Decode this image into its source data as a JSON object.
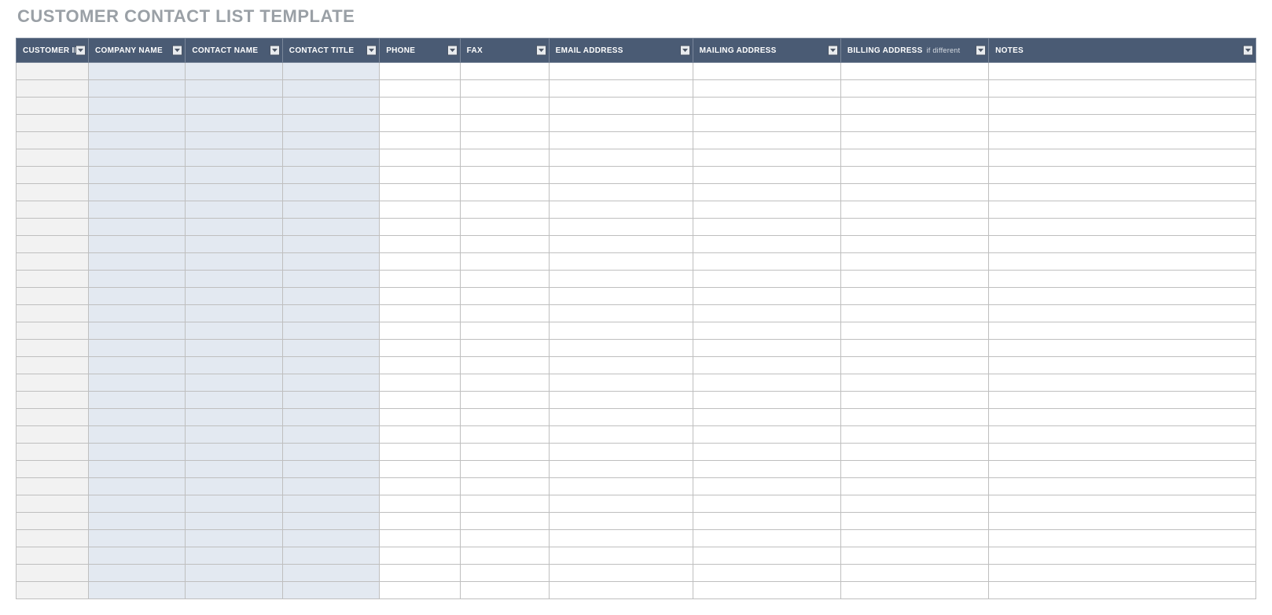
{
  "title": "CUSTOMER CONTACT LIST TEMPLATE",
  "columns": [
    {
      "label": "CUSTOMER ID",
      "sub": "",
      "style": "id"
    },
    {
      "label": "COMPANY NAME",
      "sub": "",
      "style": "blue"
    },
    {
      "label": "CONTACT NAME",
      "sub": "",
      "style": "blue"
    },
    {
      "label": "CONTACT TITLE",
      "sub": "",
      "style": "blue"
    },
    {
      "label": "PHONE",
      "sub": "",
      "style": "wh"
    },
    {
      "label": "FAX",
      "sub": "",
      "style": "wh"
    },
    {
      "label": "EMAIL ADDRESS",
      "sub": "",
      "style": "wh"
    },
    {
      "label": "MAILING ADDRESS",
      "sub": "",
      "style": "wh"
    },
    {
      "label": "BILLING ADDRESS",
      "sub": "if different",
      "style": "wh"
    },
    {
      "label": "NOTES",
      "sub": "",
      "style": "wh"
    }
  ],
  "row_count": 31,
  "colors": {
    "header_bg": "#4a5b74",
    "title_color": "#9aa0a6",
    "id_col_bg": "#f2f2f2",
    "blue_col_bg": "#e3e9f1",
    "grid_line": "#bfbfbf"
  }
}
